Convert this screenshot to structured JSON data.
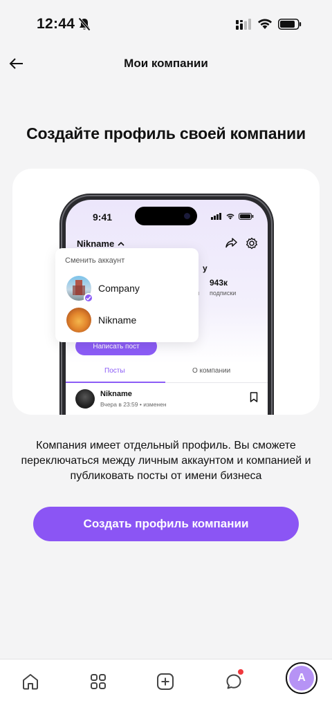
{
  "status_bar": {
    "time": "12:44",
    "icons": [
      "bell-mute-icon",
      "cellular-signal-icon",
      "wifi-icon",
      "battery-icon"
    ]
  },
  "header": {
    "title": "Мои компании",
    "back_icon": "arrow-left-icon"
  },
  "headline": "Создайте профиль своей компании",
  "illustration": {
    "phone_time": "9:41",
    "nickname": "Nikname",
    "switch_title": "Сменить аккаунт",
    "accounts": [
      {
        "name": "Company",
        "selected": true
      },
      {
        "name": "Nikname",
        "selected": false
      }
    ],
    "stat_partial": "у",
    "stat_value": "943к",
    "stat_label": "подписки",
    "stat_label_partial": "и",
    "write_post": "Написать пост",
    "tabs": [
      "Посты",
      "О компании"
    ],
    "post": {
      "author": "Nikname",
      "time": "Вчера в 23:59 • изменен"
    }
  },
  "description": "Компания имеет отдельный профиль. Вы сможете переключаться между личным аккаунтом и компанией и публиковать посты от имени бизнеса",
  "create_button": "Создать профиль компании",
  "bottom_nav": {
    "items": [
      "home-icon",
      "apps-grid-icon",
      "add-post-icon",
      "chat-icon",
      "profile-avatar"
    ],
    "profile_initial": "А"
  },
  "colors": {
    "accent": "#8b55f4",
    "background": "#f4f4f5",
    "notification": "#f0393d"
  }
}
